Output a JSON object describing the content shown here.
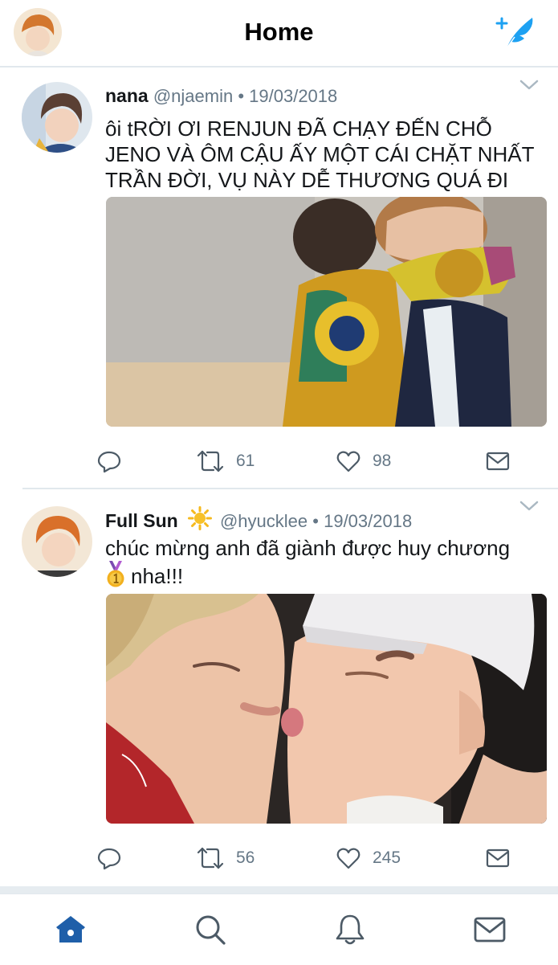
{
  "header": {
    "title": "Home"
  },
  "icons": {
    "compose": "compose-feather-icon",
    "caret": "chevron-down-icon",
    "reply": "reply-icon",
    "retweet": "retweet-icon",
    "like": "heart-icon",
    "dm": "envelope-icon",
    "home": "home-icon",
    "search": "search-icon",
    "notifications": "bell-icon",
    "messages": "envelope-icon"
  },
  "colors": {
    "accent": "#1da1f2",
    "nav_active": "#1f5fa9",
    "muted": "#657786",
    "separator": "#e1e8ed"
  },
  "tweets": [
    {
      "name": "nana",
      "handle": "@njaemin",
      "date": "19/03/2018",
      "text_lines": [
        "ôi tRỜI ƠI RENJUN ĐÃ CHẠY ĐẾN CHỖ",
        "JENO VÀ ÔM CẬU ẤY MỘT CÁI CHẶT NHẤT",
        "TRẦN ĐỜI, VỤ NÀY DỄ THƯƠNG QUÁ ĐI"
      ],
      "retweets": "61",
      "likes": "98"
    },
    {
      "name": "Full Sun",
      "handle": "@hyucklee",
      "date": "19/03/2018",
      "text_line_1": "chúc mừng anh đã giành được huy chương",
      "text_line_2": "nha!!!",
      "retweets": "56",
      "likes": "245"
    }
  ],
  "meta_separator": "•"
}
